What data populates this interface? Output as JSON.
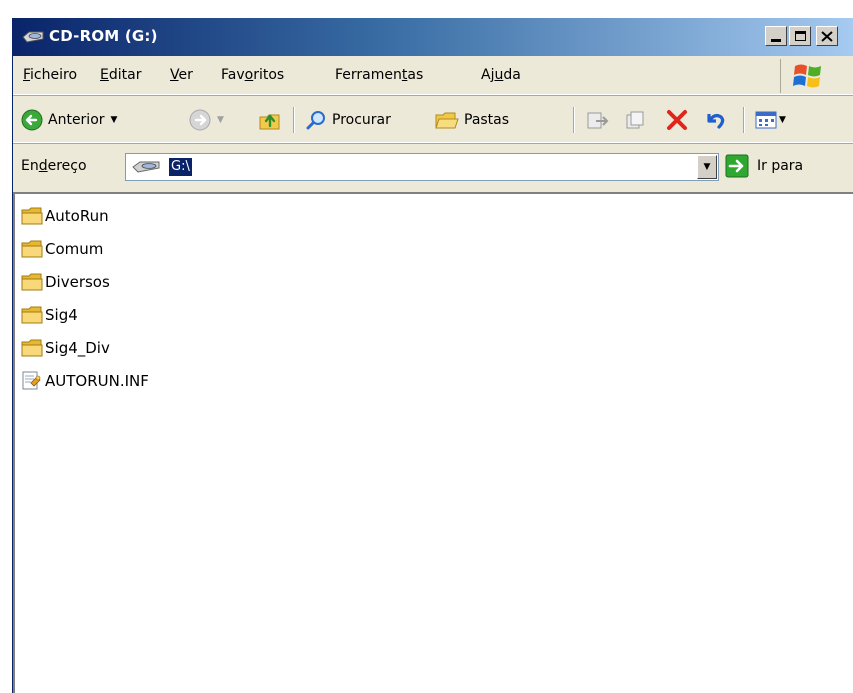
{
  "window": {
    "title": "CD-ROM (G:)"
  },
  "menu": {
    "items": [
      {
        "pre": "",
        "key": "F",
        "post": "icheiro"
      },
      {
        "pre": "",
        "key": "E",
        "post": "ditar"
      },
      {
        "pre": "",
        "key": "V",
        "post": "er"
      },
      {
        "pre": "Fav",
        "key": "o",
        "post": "ritos"
      },
      {
        "pre": "Ferramen",
        "key": "t",
        "post": "as"
      },
      {
        "pre": "Aj",
        "key": "u",
        "post": "da"
      }
    ]
  },
  "toolbar": {
    "back_label": "Anterior",
    "search_label": "Procurar",
    "folders_label": "Pastas"
  },
  "address": {
    "label_pre": "En",
    "label_key": "d",
    "label_post": "ereço",
    "value": "G:\\",
    "go_label": "Ir para"
  },
  "files": [
    {
      "name": "AutoRun",
      "type": "folder"
    },
    {
      "name": "Comum",
      "type": "folder"
    },
    {
      "name": "Diversos",
      "type": "folder"
    },
    {
      "name": "Sig4",
      "type": "folder"
    },
    {
      "name": "Sig4_Div",
      "type": "folder"
    },
    {
      "name": "AUTORUN.INF",
      "type": "setup-file"
    }
  ],
  "colors": {
    "title_start": "#0a246a",
    "title_end": "#a6caf0",
    "chrome": "#ece9d8",
    "selection": "#0a246a",
    "delete_red": "#e0261b",
    "go_green": "#2fa82f"
  }
}
